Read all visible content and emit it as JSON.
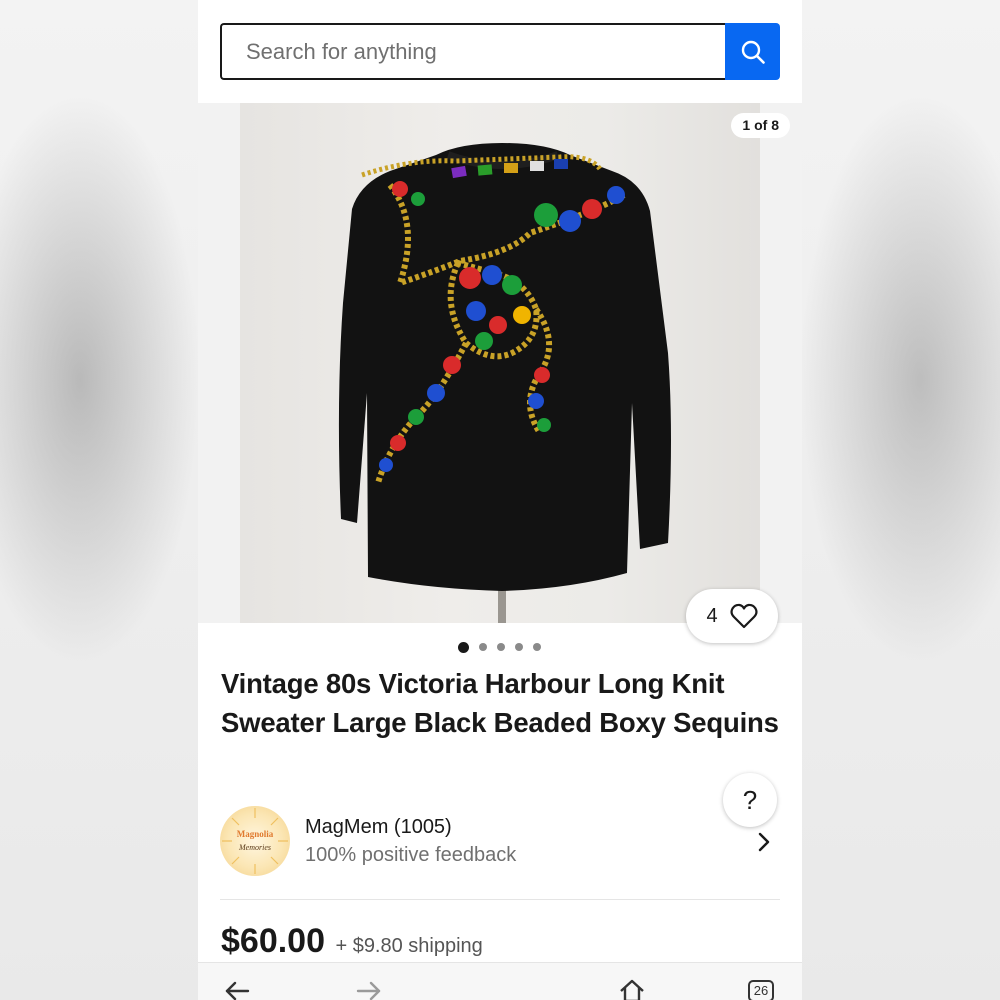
{
  "search": {
    "placeholder": "Search for anything"
  },
  "gallery": {
    "counter": "1 of 8",
    "watch_count": "4",
    "dots_total": 5,
    "dots_active_index": 0
  },
  "listing": {
    "title": "Vintage 80s Victoria Harbour Long Knit Sweater Large Black Beaded Boxy Sequins",
    "price": "$60.00",
    "shipping": "+ $9.80 shipping"
  },
  "seller": {
    "name": "MagMem (1005)",
    "feedback": "100% positive feedback",
    "avatar_text_top": "Magnolia",
    "avatar_text_bottom": "Memories"
  },
  "help": {
    "label": "?"
  },
  "nav": {
    "tabs_count": "26"
  },
  "colors": {
    "accent_blue": "#0868f2",
    "text_primary": "#191919",
    "text_secondary": "#707070"
  }
}
